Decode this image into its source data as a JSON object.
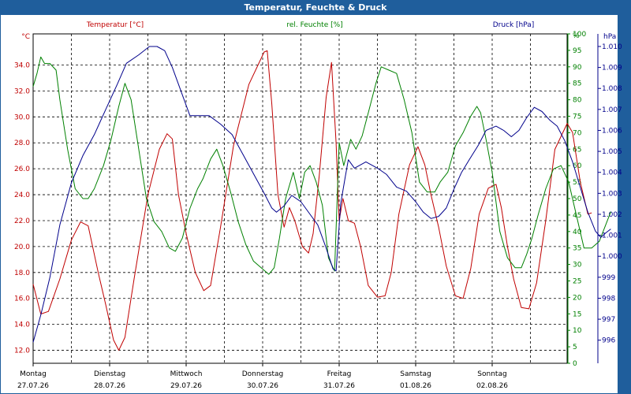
{
  "window": {
    "title": "Temperatur, Feuchte & Druck"
  },
  "colors": {
    "temp": "#c00000",
    "hum": "#008000",
    "press": "#00008b",
    "accent": "#1f5e9c"
  },
  "chart_data": {
    "type": "line",
    "title": "Temperatur, Feuchte & Druck",
    "axes": {
      "temp": {
        "label": "Temperatur [°C]",
        "unit": "°C",
        "min": 11,
        "max": 36.4,
        "ticks": [
          12.0,
          14.0,
          16.0,
          18.0,
          20.0,
          22.0,
          24.0,
          26.0,
          28.0,
          30.0,
          32.0,
          34.0
        ]
      },
      "hum": {
        "label": "rel. Feuchte [%]",
        "unit": "%",
        "min": 0,
        "max": 100,
        "ticks": [
          0,
          5,
          10,
          15,
          20,
          25,
          30,
          35,
          40,
          45,
          50,
          55,
          60,
          65,
          70,
          75,
          80,
          85,
          90,
          95,
          100
        ]
      },
      "press": {
        "label": "Druck [hPa]",
        "unit": "hPa",
        "min": 994.9,
        "max": 1010.6,
        "ticks": [
          996,
          997,
          998,
          999,
          1000,
          1001,
          1002,
          1003,
          1004,
          1005,
          1006,
          1007,
          1008,
          1009,
          1010
        ]
      }
    },
    "x_range": [
      0,
      7
    ],
    "x_ticks": [
      {
        "x": 0,
        "day": "Montag",
        "date": "27.07.26"
      },
      {
        "x": 1,
        "day": "Dienstag",
        "date": "28.07.26"
      },
      {
        "x": 2,
        "day": "Mittwoch",
        "date": "29.07.26"
      },
      {
        "x": 3,
        "day": "Donnerstag",
        "date": "30.07.26"
      },
      {
        "x": 4,
        "day": "Freitag",
        "date": "31.07.26"
      },
      {
        "x": 5,
        "day": "Samstag",
        "date": "01.08.26"
      },
      {
        "x": 6,
        "day": "Sonntag",
        "date": "02.08.26"
      }
    ],
    "grid": true,
    "series": [
      {
        "name": "Temperatur [°C]",
        "axis": "temp",
        "color": "#c00000",
        "points": [
          [
            0,
            17.1
          ],
          [
            0.1,
            14.8
          ],
          [
            0.2,
            15.0
          ],
          [
            0.35,
            17.5
          ],
          [
            0.5,
            20.5
          ],
          [
            0.62,
            21.9
          ],
          [
            0.72,
            21.6
          ],
          [
            0.85,
            18.0
          ],
          [
            0.95,
            15.5
          ],
          [
            1.05,
            12.8
          ],
          [
            1.12,
            12.0
          ],
          [
            1.2,
            13.0
          ],
          [
            1.32,
            17.5
          ],
          [
            1.5,
            24.0
          ],
          [
            1.65,
            27.5
          ],
          [
            1.75,
            28.7
          ],
          [
            1.82,
            28.3
          ],
          [
            1.9,
            24.0
          ],
          [
            2.0,
            21.0
          ],
          [
            2.12,
            18.0
          ],
          [
            2.23,
            16.6
          ],
          [
            2.32,
            17.0
          ],
          [
            2.45,
            21.5
          ],
          [
            2.62,
            27.8
          ],
          [
            2.82,
            32.5
          ],
          [
            3.02,
            35.0
          ],
          [
            3.06,
            35.1
          ],
          [
            3.12,
            31.0
          ],
          [
            3.2,
            24.0
          ],
          [
            3.28,
            21.5
          ],
          [
            3.35,
            23.0
          ],
          [
            3.42,
            22.0
          ],
          [
            3.52,
            20.0
          ],
          [
            3.6,
            19.5
          ],
          [
            3.66,
            21.0
          ],
          [
            3.74,
            25.5
          ],
          [
            3.83,
            31.5
          ],
          [
            3.9,
            34.2
          ],
          [
            3.96,
            28.0
          ],
          [
            4.0,
            22.0
          ],
          [
            4.05,
            23.7
          ],
          [
            4.12,
            22.0
          ],
          [
            4.2,
            21.8
          ],
          [
            4.28,
            20.0
          ],
          [
            4.38,
            17.0
          ],
          [
            4.5,
            16.1
          ],
          [
            4.6,
            16.2
          ],
          [
            4.68,
            18.0
          ],
          [
            4.78,
            22.5
          ],
          [
            4.92,
            26.3
          ],
          [
            5.03,
            27.7
          ],
          [
            5.12,
            26.3
          ],
          [
            5.2,
            24.0
          ],
          [
            5.3,
            21.5
          ],
          [
            5.4,
            18.5
          ],
          [
            5.52,
            16.2
          ],
          [
            5.62,
            16.0
          ],
          [
            5.72,
            18.3
          ],
          [
            5.83,
            22.5
          ],
          [
            5.95,
            24.5
          ],
          [
            6.05,
            24.8
          ],
          [
            6.12,
            23.0
          ],
          [
            6.2,
            20.0
          ],
          [
            6.28,
            17.5
          ],
          [
            6.38,
            15.3
          ],
          [
            6.48,
            15.2
          ],
          [
            6.58,
            17.2
          ],
          [
            6.7,
            22.0
          ],
          [
            6.82,
            27.5
          ],
          [
            6.98,
            29.5
          ],
          [
            7.05,
            28.8
          ],
          [
            7.15,
            25.0
          ],
          [
            7.25,
            22.5
          ],
          [
            7.3,
            22.6
          ]
        ]
      },
      {
        "name": "rel. Feuchte [%]",
        "axis": "hum",
        "color": "#008000",
        "points": [
          [
            0,
            84
          ],
          [
            0.05,
            88
          ],
          [
            0.1,
            93
          ],
          [
            0.15,
            91
          ],
          [
            0.22,
            91
          ],
          [
            0.3,
            89
          ],
          [
            0.35,
            80
          ],
          [
            0.45,
            65
          ],
          [
            0.55,
            53
          ],
          [
            0.65,
            50
          ],
          [
            0.72,
            50
          ],
          [
            0.8,
            53
          ],
          [
            0.92,
            60
          ],
          [
            1.02,
            68
          ],
          [
            1.12,
            78
          ],
          [
            1.2,
            85
          ],
          [
            1.28,
            80
          ],
          [
            1.38,
            65
          ],
          [
            1.48,
            50
          ],
          [
            1.58,
            43
          ],
          [
            1.68,
            40
          ],
          [
            1.78,
            35
          ],
          [
            1.86,
            34
          ],
          [
            1.95,
            38
          ],
          [
            2.05,
            47
          ],
          [
            2.15,
            53
          ],
          [
            2.22,
            56
          ],
          [
            2.32,
            62
          ],
          [
            2.4,
            65
          ],
          [
            2.48,
            60
          ],
          [
            2.58,
            52
          ],
          [
            2.68,
            43
          ],
          [
            2.78,
            36
          ],
          [
            2.88,
            31
          ],
          [
            2.98,
            29
          ],
          [
            3.08,
            27
          ],
          [
            3.15,
            29
          ],
          [
            3.22,
            38
          ],
          [
            3.3,
            50
          ],
          [
            3.4,
            58
          ],
          [
            3.48,
            50
          ],
          [
            3.55,
            58
          ],
          [
            3.62,
            60
          ],
          [
            3.7,
            55
          ],
          [
            3.78,
            48
          ],
          [
            3.86,
            32
          ],
          [
            3.94,
            28
          ],
          [
            4.0,
            67
          ],
          [
            4.06,
            60
          ],
          [
            4.15,
            68
          ],
          [
            4.22,
            65
          ],
          [
            4.3,
            69
          ],
          [
            4.38,
            76
          ],
          [
            4.48,
            85
          ],
          [
            4.55,
            90
          ],
          [
            4.65,
            89
          ],
          [
            4.75,
            88
          ],
          [
            4.85,
            80
          ],
          [
            4.95,
            70
          ],
          [
            5.05,
            55
          ],
          [
            5.15,
            52
          ],
          [
            5.25,
            52
          ],
          [
            5.32,
            55
          ],
          [
            5.42,
            58
          ],
          [
            5.52,
            66
          ],
          [
            5.62,
            70
          ],
          [
            5.72,
            75
          ],
          [
            5.8,
            78
          ],
          [
            5.85,
            76
          ],
          [
            5.92,
            68
          ],
          [
            6.0,
            58
          ],
          [
            6.1,
            40
          ],
          [
            6.2,
            32
          ],
          [
            6.3,
            29
          ],
          [
            6.38,
            29
          ],
          [
            6.45,
            33
          ],
          [
            6.52,
            38
          ],
          [
            6.6,
            45
          ],
          [
            6.7,
            53
          ],
          [
            6.8,
            59
          ],
          [
            6.9,
            60
          ],
          [
            7.0,
            55
          ],
          [
            7.1,
            45
          ],
          [
            7.2,
            35
          ],
          [
            7.3,
            35
          ],
          [
            7.4,
            37
          ],
          [
            7.5,
            43
          ],
          [
            7.55,
            46
          ]
        ]
      },
      {
        "name": "Druck [hPa]",
        "axis": "press",
        "color": "#00008b",
        "points": [
          [
            0,
            995.9
          ],
          [
            0.1,
            997.2
          ],
          [
            0.22,
            999.0
          ],
          [
            0.35,
            1001.5
          ],
          [
            0.5,
            1003.5
          ],
          [
            0.65,
            1004.8
          ],
          [
            0.8,
            1005.8
          ],
          [
            0.95,
            1007.0
          ],
          [
            1.1,
            1008.2
          ],
          [
            1.22,
            1009.2
          ],
          [
            1.38,
            1009.6
          ],
          [
            1.52,
            1010.0
          ],
          [
            1.62,
            1010.0
          ],
          [
            1.72,
            1009.8
          ],
          [
            1.82,
            1009.0
          ],
          [
            1.92,
            1008.0
          ],
          [
            2.05,
            1006.7
          ],
          [
            2.15,
            1006.7
          ],
          [
            2.3,
            1006.7
          ],
          [
            2.45,
            1006.3
          ],
          [
            2.6,
            1005.8
          ],
          [
            2.75,
            1004.8
          ],
          [
            2.9,
            1003.8
          ],
          [
            3.02,
            1003.0
          ],
          [
            3.12,
            1002.3
          ],
          [
            3.18,
            1002.1
          ],
          [
            3.28,
            1002.4
          ],
          [
            3.38,
            1002.9
          ],
          [
            3.5,
            1002.6
          ],
          [
            3.62,
            1002.0
          ],
          [
            3.72,
            1001.5
          ],
          [
            3.82,
            1000.5
          ],
          [
            3.92,
            999.4
          ],
          [
            3.96,
            999.3
          ],
          [
            4.02,
            1002.5
          ],
          [
            4.08,
            1003.8
          ],
          [
            4.12,
            1004.6
          ],
          [
            4.2,
            1004.2
          ],
          [
            4.35,
            1004.5
          ],
          [
            4.5,
            1004.2
          ],
          [
            4.62,
            1003.9
          ],
          [
            4.75,
            1003.3
          ],
          [
            4.88,
            1003.1
          ],
          [
            5.0,
            1002.6
          ],
          [
            5.1,
            1002.1
          ],
          [
            5.2,
            1001.8
          ],
          [
            5.3,
            1001.9
          ],
          [
            5.4,
            1002.3
          ],
          [
            5.5,
            1003.2
          ],
          [
            5.6,
            1004.0
          ],
          [
            5.7,
            1004.6
          ],
          [
            5.82,
            1005.3
          ],
          [
            5.92,
            1006.0
          ],
          [
            6.05,
            1006.2
          ],
          [
            6.15,
            1006.0
          ],
          [
            6.25,
            1005.7
          ],
          [
            6.35,
            1006.0
          ],
          [
            6.45,
            1006.6
          ],
          [
            6.55,
            1007.1
          ],
          [
            6.65,
            1006.9
          ],
          [
            6.75,
            1006.5
          ],
          [
            6.85,
            1006.2
          ],
          [
            6.95,
            1005.5
          ],
          [
            7.05,
            1004.5
          ],
          [
            7.15,
            1003.3
          ],
          [
            7.25,
            1002.1
          ],
          [
            7.35,
            1001.2
          ],
          [
            7.42,
            1000.9
          ],
          [
            7.48,
            1001.1
          ],
          [
            7.55,
            1001.3
          ]
        ]
      }
    ]
  }
}
